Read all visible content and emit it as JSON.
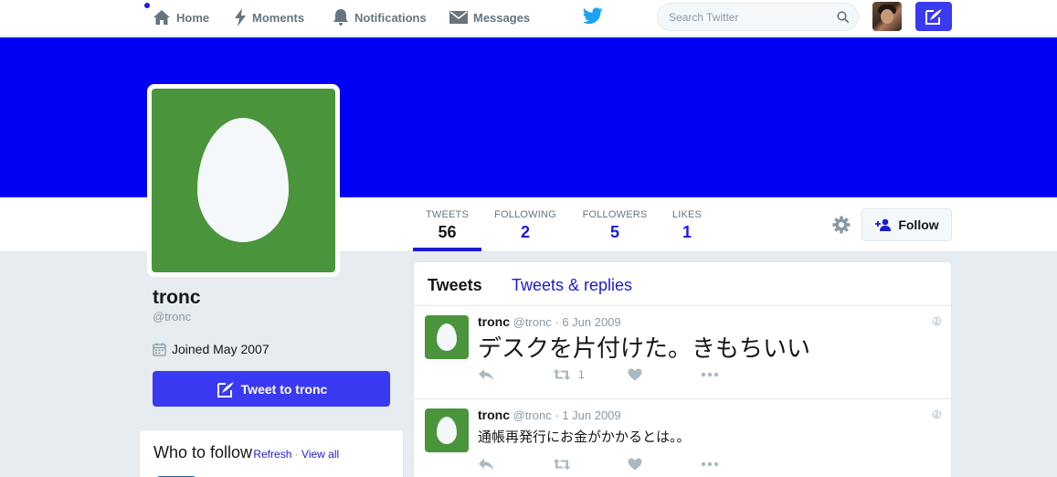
{
  "nav": {
    "items": [
      {
        "label": "Home",
        "icon": "home-icon"
      },
      {
        "label": "Moments",
        "icon": "lightning-icon"
      },
      {
        "label": "Notifications",
        "icon": "bell-icon"
      },
      {
        "label": "Messages",
        "icon": "envelope-icon"
      }
    ],
    "search_placeholder": "Search Twitter",
    "brand_icon": "twitter-bird-icon",
    "accent": "#1da1f2"
  },
  "profile": {
    "name": "tronc",
    "handle": "@tronc",
    "joined": "Joined May 2007",
    "banner_color": "#0000f5",
    "avatar_bg": "#4a943c",
    "tweet_to_label": "Tweet to tronc",
    "follow_label": "Follow"
  },
  "stats": [
    {
      "label": "TWEETS",
      "value": "56"
    },
    {
      "label": "FOLLOWING",
      "value": "2"
    },
    {
      "label": "FOLLOWERS",
      "value": "5"
    },
    {
      "label": "LIKES",
      "value": "1"
    }
  ],
  "who_to_follow": {
    "title": "Who to follow",
    "sep": " · ",
    "refresh": "Refresh",
    "view_all": "View all"
  },
  "timeline": {
    "tabs": [
      "Tweets",
      "Tweets & replies"
    ],
    "tweets": [
      {
        "name": "tronc",
        "handle": "@tronc",
        "date": "6 Jun 2009",
        "text": "デスクを片付けた。きもちいい",
        "retweets": "1",
        "likes": ""
      },
      {
        "name": "tronc",
        "handle": "@tronc",
        "date": "1 Jun 2009",
        "text": "通帳再発行にお金がかかるとは。。",
        "retweets": "",
        "likes": ""
      }
    ]
  },
  "colors": {
    "link": "#1b1bd6",
    "primary_button": "#3a3af2",
    "muted": "#8899a6"
  }
}
